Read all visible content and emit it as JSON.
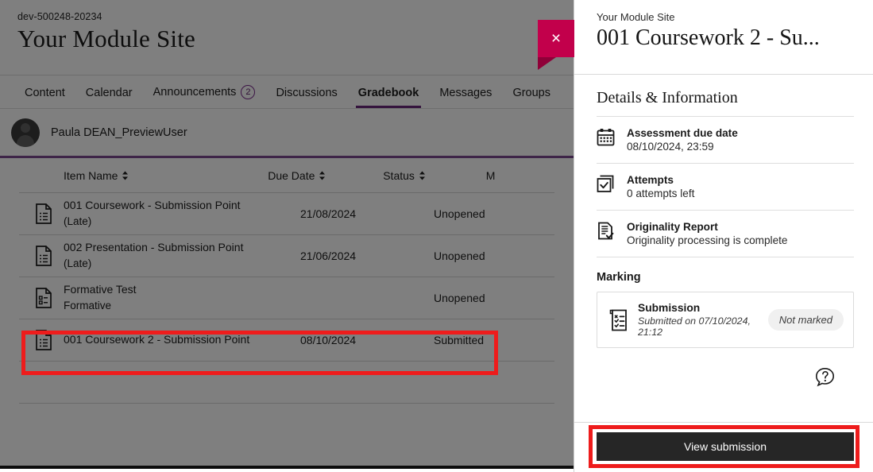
{
  "background": {
    "site_id": "dev-500248-20234",
    "site_title": "Your Module Site",
    "nav_tabs": [
      {
        "label": "Content",
        "active": false,
        "badge": null
      },
      {
        "label": "Calendar",
        "active": false,
        "badge": null
      },
      {
        "label": "Announcements",
        "active": false,
        "badge": "2"
      },
      {
        "label": "Discussions",
        "active": false,
        "badge": null
      },
      {
        "label": "Gradebook",
        "active": true,
        "badge": null
      },
      {
        "label": "Messages",
        "active": false,
        "badge": null
      },
      {
        "label": "Groups",
        "active": false,
        "badge": null
      }
    ],
    "user": {
      "name": "Paula DEAN_PreviewUser",
      "avatar": "user-avatar"
    },
    "table": {
      "columns": [
        {
          "label": "Item Name",
          "sortable": true
        },
        {
          "label": "Due Date",
          "sortable": true
        },
        {
          "label": "Status",
          "sortable": true
        },
        {
          "label": "M",
          "sortable": false
        }
      ],
      "rows": [
        {
          "icon": "assignment-document-icon",
          "name": "001 Coursework - Submission Point",
          "sub": "(Late)",
          "due": "21/08/2024",
          "status": "Unopened",
          "highlighted": false
        },
        {
          "icon": "assignment-document-icon",
          "name": "002 Presentation - Submission Point",
          "sub": "(Late)",
          "due": "21/06/2024",
          "status": "Unopened",
          "highlighted": false
        },
        {
          "icon": "test-document-icon",
          "name": "Formative Test",
          "sub": "Formative",
          "due": "",
          "status": "Unopened",
          "highlighted": false
        },
        {
          "icon": "assignment-document-icon",
          "name": "001 Coursework 2 - Submission Point",
          "sub": "",
          "due": "08/10/2024",
          "status": "Submitted",
          "highlighted": true
        }
      ]
    }
  },
  "panel": {
    "close_label": "×",
    "eyebrow": "Your Module Site",
    "title": "001 Coursework 2 - Su...",
    "details_heading": "Details & Information",
    "details": [
      {
        "icon": "calendar-icon",
        "label": "Assessment due date",
        "value": "08/10/2024, 23:59"
      },
      {
        "icon": "attempts-checkbox-icon",
        "label": "Attempts",
        "value": "0 attempts left"
      },
      {
        "icon": "originality-report-icon",
        "label": "Originality Report",
        "value": "Originality processing is complete"
      }
    ],
    "marking_heading": "Marking",
    "marking_card": {
      "icon": "submission-checklist-icon",
      "title": "Submission",
      "subtitle": "Submitted on 07/10/2024, 21:12",
      "status_pill": "Not marked"
    },
    "help_icon": "help-question-bubble-icon",
    "primary_button": "View submission"
  },
  "colors": {
    "brand_purple": "#69267a",
    "close_crimson": "#c2004b",
    "annotation_red": "#ee1c1c",
    "button_dark": "#262626",
    "divider": "#dedede"
  }
}
